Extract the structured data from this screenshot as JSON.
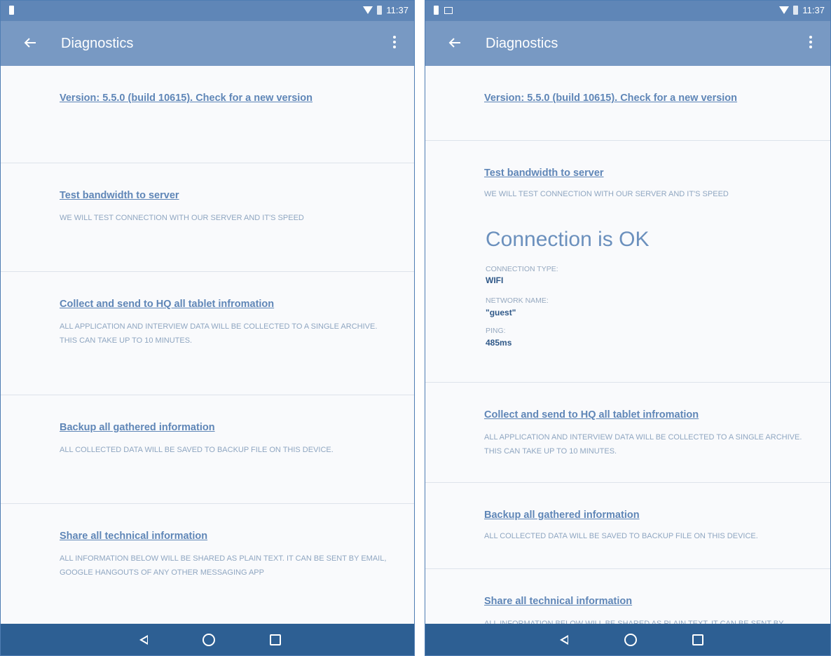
{
  "statusbar": {
    "time": "11:37"
  },
  "appbar": {
    "title": "Diagnostics"
  },
  "version": {
    "label": "Version: 5.5.0 (build 10615). Check for a new version"
  },
  "bandwidth": {
    "title": "Test bandwidth to server",
    "desc": "We will test connection with our server and it's speed",
    "result": "Connection is OK",
    "type_label": "Connection type:",
    "type_value": "WIFI",
    "network_label": "Network name:",
    "network_value": "\"guest\"",
    "ping_label": "Ping:",
    "ping_value": "485ms"
  },
  "collect": {
    "title": "Collect and send to HQ all tablet infromation",
    "desc": "All application and interview data will be collected to a single archive. This can take up to 10 minutes."
  },
  "backup": {
    "title": "Backup all gathered information",
    "desc": "All collected data will be saved to backup file on this device."
  },
  "share": {
    "title": "Share all technical information",
    "desc": "All information below will be shared as plain text. It can be sent by email, google hangouts of any other messaging app"
  },
  "colors": {
    "statusbar": "#5f86b7",
    "appbar": "#7899c3",
    "navbar": "#2d5f93",
    "link": "#5f86b7"
  },
  "icons": [
    "battery-icon",
    "image-notification-icon",
    "wifi-icon",
    "back-arrow-icon",
    "overflow-menu-icon",
    "nav-back-icon",
    "nav-home-icon",
    "nav-recents-icon"
  ]
}
